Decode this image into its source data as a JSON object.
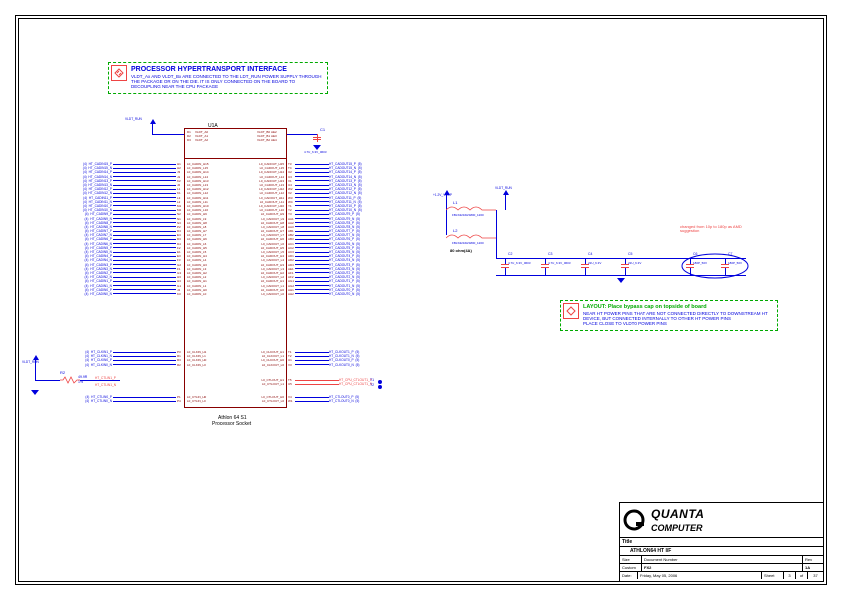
{
  "note1": {
    "title": "PROCESSOR HYPERTRANSPORT INTERFACE",
    "body": "VLDT_Ax AND VLDT_Bx ARE CONNECTED TO THE LDT_RUN POWER SUPPLY THROUGH THE PACKAGE OR ON THE DIE. IT IS ONLY CONNECTED ON THE BOARD TO DECOUPLING NEAR THE CPU PACKAGE"
  },
  "note2": {
    "title": "LAYOUT: Place bypass cap on topside of board",
    "body": "NEAR HT POWER PINS THAT ARE NOT CONNECTED DIRECTLY TO DOWNSTREAM HT DEVICE, BUT CONNECTED INTERNALLY TO OTHER HT POWER PINS<br>PLACE CLOSE TO VLDT0 POWER PINS"
  },
  "chip": {
    "refdes": "U1A",
    "desc1": "Athlon 64 S1",
    "desc2": "Processor Socket"
  },
  "power": {
    "vldt_run": "VLDT_RUN",
    "vccp": "+1.2V_VCCP",
    "ind1": "FBLS3216HS800_1200",
    "ind2": "FBLS3216HS800_1200",
    "ind_note": "80 ohm(4A)",
    "l1": "L1",
    "l2": "L2"
  },
  "top_pins": {
    "left": [
      "VLDT_A0",
      "VLDT_A1",
      "VLDT_A2"
    ],
    "right": [
      "VLDT_B0",
      "VLDT_B1",
      "VLDT_B2"
    ],
    "pins_left": [
      "D1",
      "D2",
      "D3"
    ],
    "pins_right": [
      "AE2",
      "AE3",
      "AE4"
    ]
  },
  "cap_row": {
    "c1": {
      "ref": "C1",
      "val": "4.7U_6.3V_0603"
    },
    "c2": {
      "ref": "C2",
      "val": "4.7U_6.3V_0603"
    },
    "c3": {
      "ref": "C3",
      "val": "4.7U_6.3V_0603"
    },
    "c4": {
      "ref": "C4",
      "val": "22U_6.3V"
    },
    "c5": {
      "ref": "C5",
      "val": "22U_6.3V"
    },
    "c6": {
      "ref": "C6",
      "val": "180P_50V"
    },
    "c7": {
      "ref": "C7",
      "val": "180P_50V"
    }
  },
  "change_note": "changed from 10p to 180p as AMD suggestion",
  "left_signals": [
    "HT_CADIN15_P",
    "HT_CADIN15_N",
    "HT_CADIN14_P",
    "HT_CADIN14_N",
    "HT_CADIN13_P",
    "HT_CADIN13_N",
    "HT_CADIN12_P",
    "HT_CADIN12_N",
    "HT_CADIN11_P",
    "HT_CADIN11_N",
    "HT_CADIN10_P",
    "HT_CADIN10_N",
    "HT_CADIN9_P",
    "HT_CADIN9_N",
    "HT_CADIN8_P",
    "HT_CADIN8_N",
    "HT_CADIN7_P",
    "HT_CADIN7_N",
    "HT_CADIN6_P",
    "HT_CADIN6_N",
    "HT_CADIN5_P",
    "HT_CADIN5_N",
    "HT_CADIN4_P",
    "HT_CADIN4_N",
    "HT_CADIN3_P",
    "HT_CADIN3_N",
    "HT_CADIN2_P",
    "HT_CADIN2_N",
    "HT_CADIN1_P",
    "HT_CADIN1_N",
    "HT_CADIN0_P",
    "HT_CADIN0_N"
  ],
  "left_pins": [
    "H1",
    "H2",
    "J3",
    "J1",
    "K2",
    "J2",
    "L1",
    "K1",
    "L3",
    "L2",
    "M1",
    "M2",
    "N2",
    "N1",
    "N3",
    "P2",
    "D4",
    "E4",
    "D3",
    "D4",
    "F2",
    "E1",
    "E3",
    "F3",
    "G2",
    "F1",
    "G3",
    "H3",
    "H4",
    "G1",
    "J4",
    "K3"
  ],
  "left_inside": [
    "L0_CADIN_H15",
    "L0_CADIN_L15",
    "L0_CADIN_H14",
    "L0_CADIN_L14",
    "L0_CADIN_H13",
    "L0_CADIN_L13",
    "L0_CADIN_H12",
    "L0_CADIN_L12",
    "L0_CADIN_H11",
    "L0_CADIN_L11",
    "L0_CADIN_H10",
    "L0_CADIN_L10",
    "L0_CADIN_H9",
    "L0_CADIN_L9",
    "L0_CADIN_H8",
    "L0_CADIN_L8",
    "L0_CADIN_H7",
    "L0_CADIN_L7",
    "L0_CADIN_H6",
    "L0_CADIN_L6",
    "L0_CADIN_H5",
    "L0_CADIN_L5",
    "L0_CADIN_H4",
    "L0_CADIN_L4",
    "L0_CADIN_H3",
    "L0_CADIN_L3",
    "L0_CADIN_H2",
    "L0_CADIN_L2",
    "L0_CADIN_H1",
    "L0_CADIN_L1",
    "L0_CADIN_H0",
    "L0_CADIN_L0"
  ],
  "right_signals": [
    "HT_CADOUT15_P",
    "HT_CADOUT15_N",
    "HT_CADOUT14_P",
    "HT_CADOUT14_N",
    "HT_CADOUT13_P",
    "HT_CADOUT13_N",
    "HT_CADOUT12_P",
    "HT_CADOUT12_N",
    "HT_CADOUT11_P",
    "HT_CADOUT11_N",
    "HT_CADOUT10_P",
    "HT_CADOUT10_N",
    "HT_CADOUT9_P",
    "HT_CADOUT9_N",
    "HT_CADOUT8_P",
    "HT_CADOUT8_N",
    "HT_CADOUT7_P",
    "HT_CADOUT7_N",
    "HT_CADOUT6_P",
    "HT_CADOUT6_N",
    "HT_CADOUT5_P",
    "HT_CADOUT5_N",
    "HT_CADOUT4_P",
    "HT_CADOUT4_N",
    "HT_CADOUT3_P",
    "HT_CADOUT3_N",
    "HT_CADOUT2_P",
    "HT_CADOUT2_N",
    "HT_CADOUT1_P",
    "HT_CADOUT1_N",
    "HT_CADOUT0_P",
    "HT_CADOUT0_N"
  ],
  "right_pins": [
    "T3",
    "T4",
    "U2",
    "U3",
    "V1",
    "U4",
    "W2",
    "V2",
    "W3",
    "W4",
    "Y1",
    "Y2",
    "Y3",
    "AA1",
    "AA2",
    "AA3",
    "AB1",
    "AB2",
    "AB3",
    "AC1",
    "AC2",
    "AC3",
    "AD1",
    "AD2",
    "AD3",
    "AE1",
    "AF1",
    "AF2",
    "AG1",
    "AG2",
    "AH1",
    "AH2"
  ],
  "right_inside": [
    "L0_CADOUT_H15",
    "L0_CADOUT_L15",
    "L0_CADOUT_H14",
    "L0_CADOUT_L14",
    "L0_CADOUT_H13",
    "L0_CADOUT_L13",
    "L0_CADOUT_H12",
    "L0_CADOUT_L12",
    "L0_CADOUT_H11",
    "L0_CADOUT_L11",
    "L0_CADOUT_H10",
    "L0_CADOUT_L10",
    "L0_CADOUT_H9",
    "L0_CADOUT_L9",
    "L0_CADOUT_H8",
    "L0_CADOUT_L8",
    "L0_CADOUT_H7",
    "L0_CADOUT_L7",
    "L0_CADOUT_H6",
    "L0_CADOUT_L6",
    "L0_CADOUT_H5",
    "L0_CADOUT_L5",
    "L0_CADOUT_H4",
    "L0_CADOUT_L4",
    "L0_CADOUT_H3",
    "L0_CADOUT_L3",
    "L0_CADOUT_H2",
    "L0_CADOUT_L2",
    "L0_CADOUT_H1",
    "L0_CADOUT_L1",
    "L0_CADOUT_H0",
    "L0_CADOUT_L0"
  ],
  "clk_left": [
    "HT_CLKIN1_P",
    "HT_CLKIN1_N",
    "HT_CLKIN0_P",
    "HT_CLKIN0_N"
  ],
  "clk_left_inside": [
    "L0_CLKIN_H1",
    "L0_CLKIN_L1",
    "L0_CLKIN_H0",
    "L0_CLKIN_L0"
  ],
  "clk_left_pins": [
    "P3",
    "R1",
    "R3",
    "R2"
  ],
  "clk_right": [
    "HT_CLKOUT1_P",
    "HT_CLKOUT1_N",
    "HT_CLKOUT0_P",
    "HT_CLKOUT0_N"
  ],
  "clk_right_inside": [
    "L0_CLKOUT_H1",
    "L0_CLKOUT_L1",
    "L0_CLKOUT_H0",
    "L0_CLKOUT_L0"
  ],
  "clk_right_pins": [
    "T1",
    "T2",
    "U1",
    "V3"
  ],
  "ctl_left": [
    "HT_CTLIN0_P",
    "HT_CTLIN0_N"
  ],
  "ctl_left_inside": [
    "L0_CTLIN_H0",
    "L0_CTLIN_L0"
  ],
  "ctl_left_pins": [
    "P1",
    "P4"
  ],
  "ctl_right": [
    "HT_CTLOUT0_P",
    "HT_CTLOUT0_N"
  ],
  "ctl_right_inside": [
    "L0_CTLOUT_H0",
    "L0_CTLOUT_L0"
  ],
  "ctl_right_pins": [
    "V4",
    "W1"
  ],
  "ctl_extra_inside": [
    "L0_CTLOUT_H1",
    "L0_CTLOUT_L1"
  ],
  "ctl_extra_pins": [
    "T5",
    "U5"
  ],
  "ctl_extra_net": [
    "HT_CPU_CTLOUT1_P",
    "HT_CPU_CTLOUT1_N"
  ],
  "ctl_extra_tp": [
    "T1",
    "T2"
  ],
  "res": {
    "ref": "R2",
    "val": "49.9R",
    "tol": "1%",
    "net": "HT_CTLIN1_P",
    "net2": "HT_CTLIN1_N"
  },
  "page_ref_a": "(4)",
  "page_ref_b": "(5)",
  "titleblock": {
    "company1": "QUANTA",
    "company2": "COMPUTER",
    "title": "ATHLON64 HT I/F",
    "size_lbl": "Size",
    "size": "Custom",
    "doc_lbl": "Document Number",
    "doc": "FX2",
    "rev_lbl": "Rev",
    "rev": "1A",
    "date_lbl": "Date:",
    "date": "Friday, May 05, 2006",
    "sheet_lbl": "Sheet",
    "sheet": "3",
    "of": "of",
    "total": "37"
  }
}
